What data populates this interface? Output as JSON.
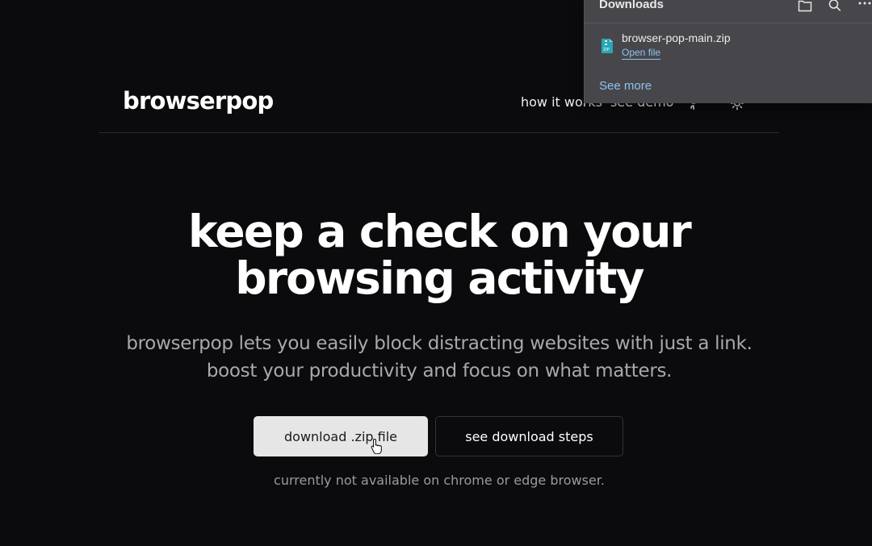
{
  "header": {
    "logo": "browserpop",
    "nav": {
      "how_it_works": "how it works",
      "see_demo": "see demo"
    },
    "icons": [
      "github-icon",
      "sun-icon"
    ]
  },
  "hero": {
    "title_line1": "keep a check on your",
    "title_line2": "browsing activity",
    "subtitle_line1": "browserpop lets you easily block distracting websites with just a link.",
    "subtitle_line2": "boost your productivity and focus on what matters.",
    "primary_button": "download .zip file",
    "secondary_button": "see download steps",
    "note": "currently not available on chrome or edge browser."
  },
  "downloads_panel": {
    "title": "Downloads",
    "tools": [
      "folder-icon",
      "search-icon",
      "more-icon"
    ],
    "item": {
      "filename": "browser-pop-main.zip",
      "action": "Open file",
      "icon": "zip-file-icon"
    },
    "see_more": "See more"
  },
  "colors": {
    "background": "#0b0a0c",
    "primary_button_bg": "#e6e6e6",
    "panel_bg": "#47474b",
    "link": "#8fc1f0"
  }
}
